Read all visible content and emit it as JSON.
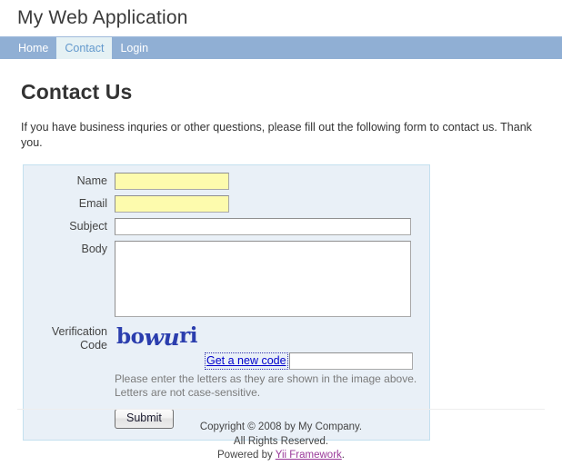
{
  "header": {
    "logo": "My Web Application"
  },
  "nav": {
    "items": [
      {
        "label": "Home",
        "active": false
      },
      {
        "label": "Contact",
        "active": true
      },
      {
        "label": "Login",
        "active": false
      }
    ]
  },
  "page": {
    "title": "Contact Us",
    "intro": "If you have business inquries or other questions, please fill out the following form to contact us. Thank you."
  },
  "form": {
    "fields": {
      "name": {
        "label": "Name",
        "value": "",
        "placeholder": ""
      },
      "email": {
        "label": "Email",
        "value": "",
        "placeholder": ""
      },
      "subject": {
        "label": "Subject",
        "value": "",
        "placeholder": ""
      },
      "body": {
        "label": "Body",
        "value": "",
        "placeholder": ""
      }
    },
    "verification": {
      "label_line1": "Verification",
      "label_line2": "Code",
      "captcha_text": "bowuri",
      "captcha_part1": "bo",
      "captcha_part2": "wu",
      "captcha_part3": "ri",
      "new_code_link": "Get a new code",
      "input_value": "",
      "hint_line1": "Please enter the letters as they are shown in the image above.",
      "hint_line2": "Letters are not case-sensitive."
    },
    "submit_label": "Submit"
  },
  "footer": {
    "line1": "Copyright © 2008 by My Company.",
    "line2": "All Rights Reserved.",
    "powered_prefix": "Powered by ",
    "powered_link": "Yii Framework",
    "powered_suffix": "."
  },
  "colors": {
    "nav_bg": "#90afd4",
    "nav_active_bg": "#e5f1f4",
    "nav_active_text": "#6399cd",
    "form_bg": "#e9f0f7",
    "form_border": "#c4e0ef",
    "autofill": "#fdfbad",
    "captcha_text": "#2b3eae",
    "link": "#0000cc",
    "visited_link": "#9a3a9a"
  }
}
